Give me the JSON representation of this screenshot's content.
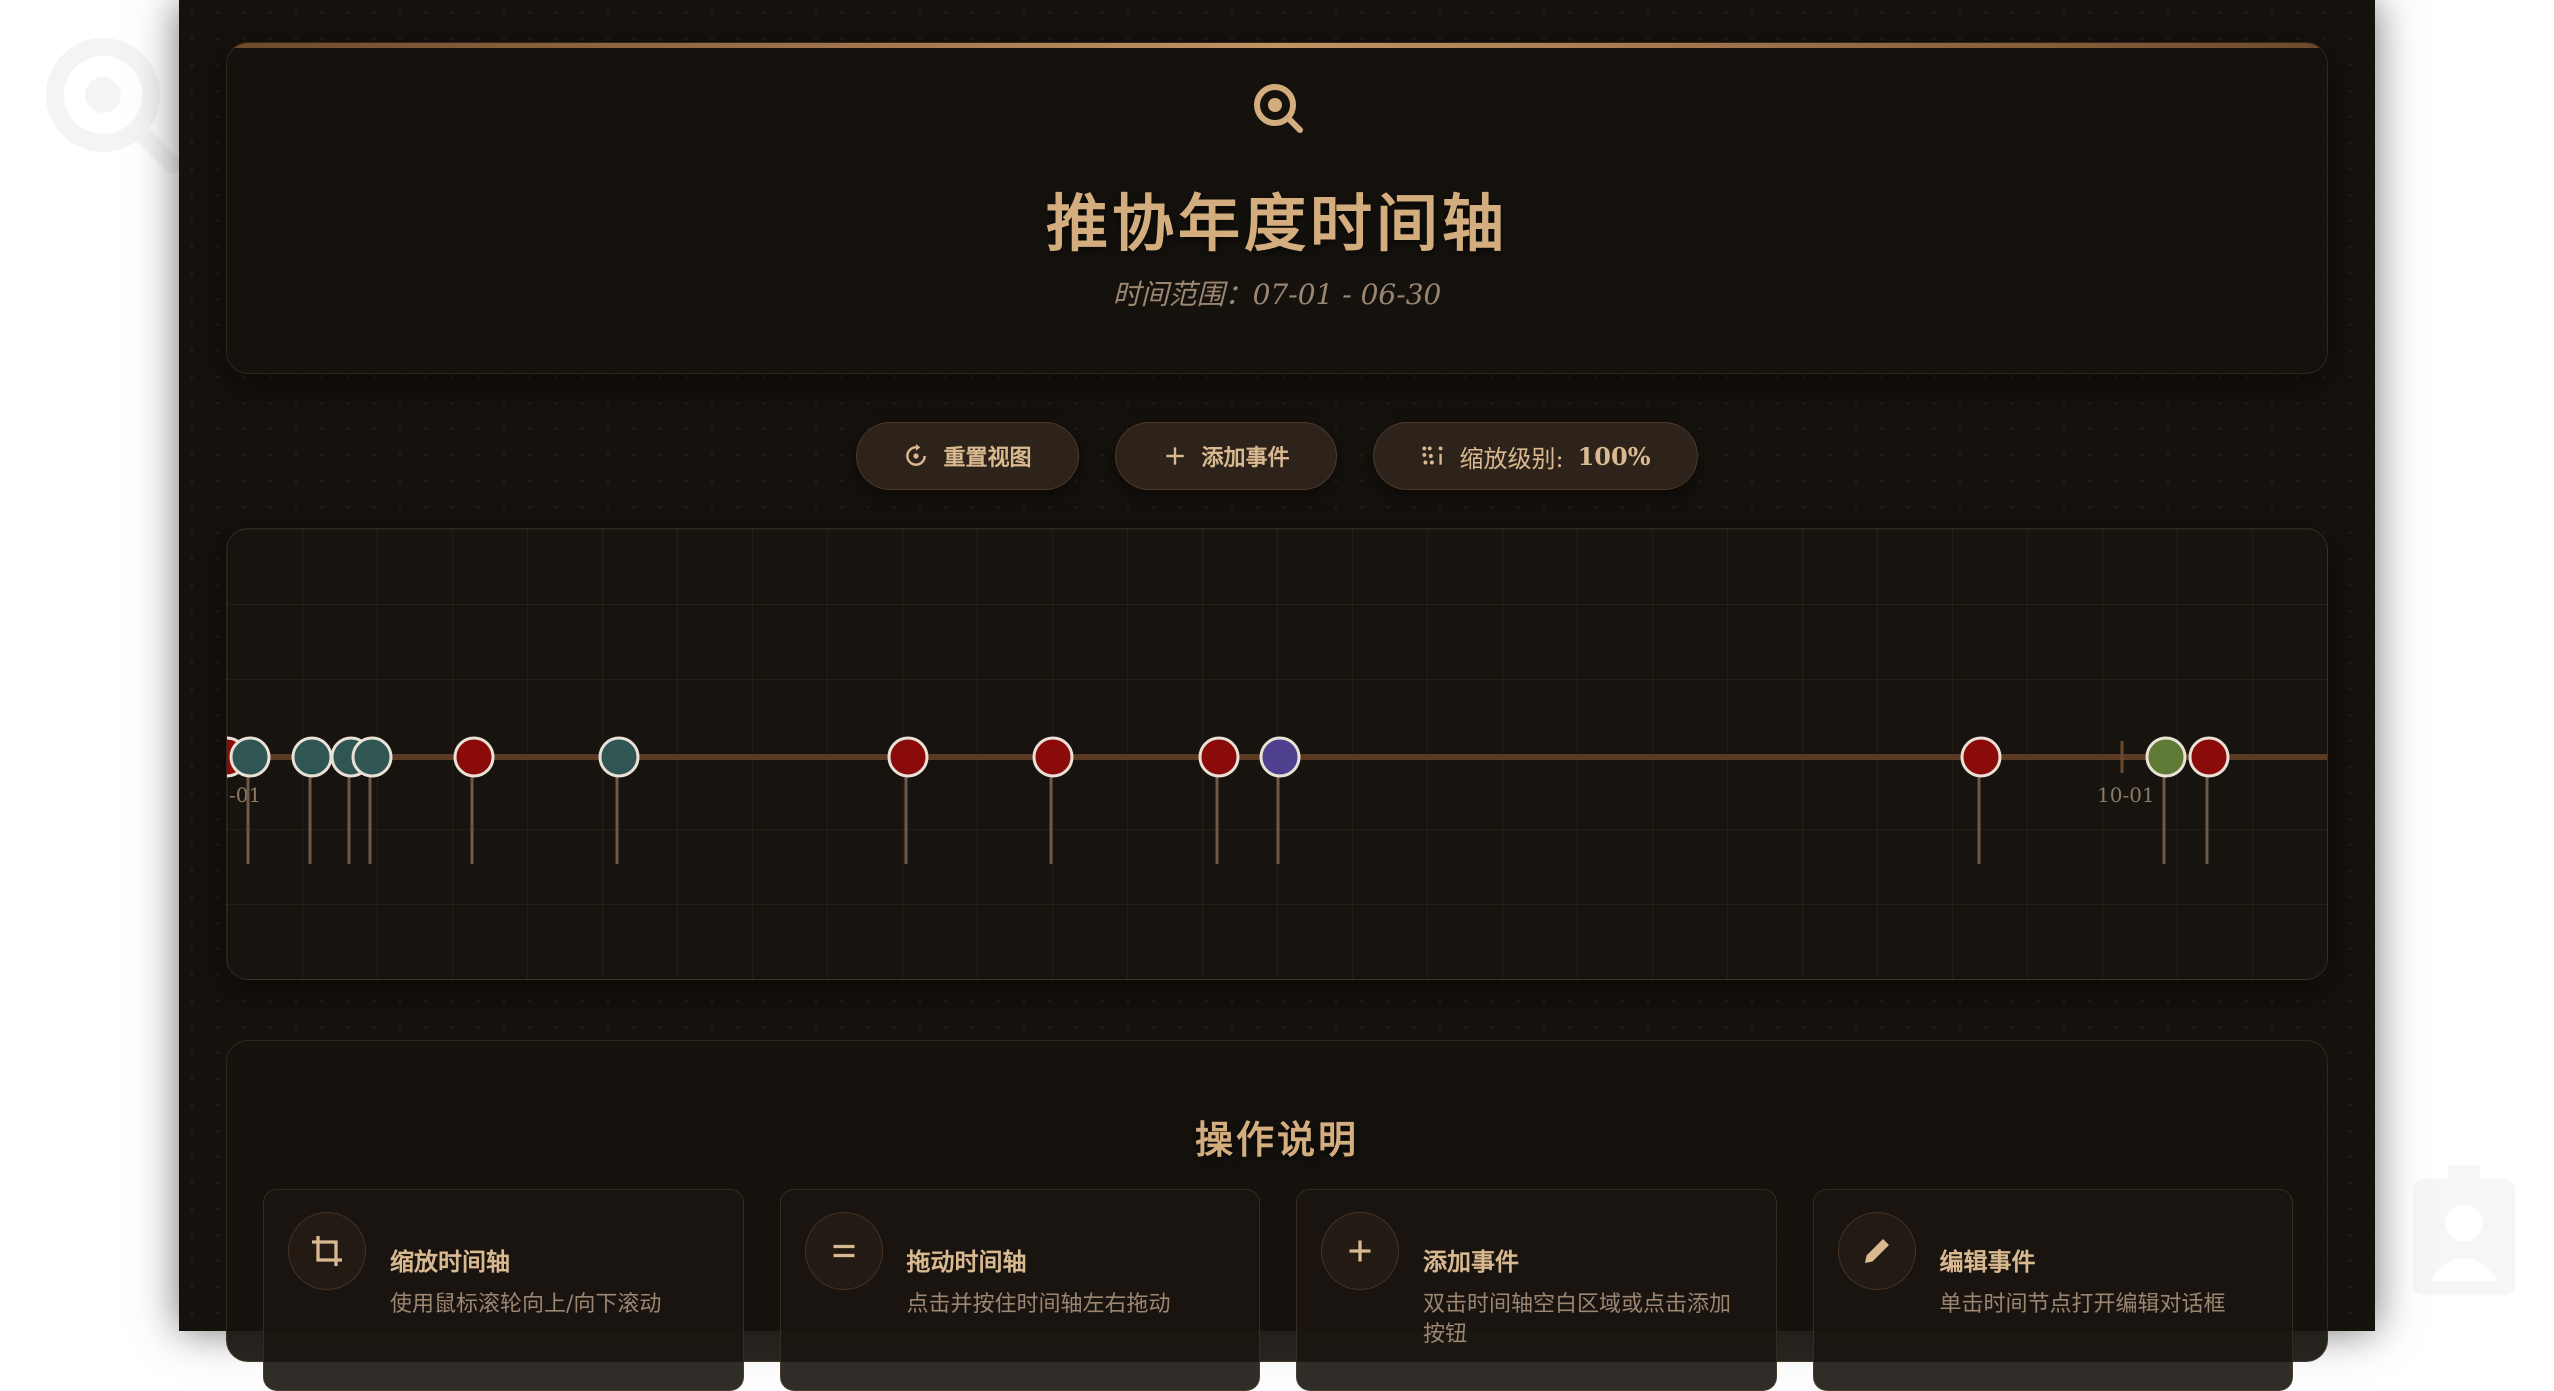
{
  "header": {
    "title": "推协年度时间轴",
    "subtitle": "时间范围：07-01 - 06-30"
  },
  "toolbar": {
    "reset_label": "重置视图",
    "add_label": "添加事件",
    "zoom_prefix": "缩放级别:",
    "zoom_value": "100%"
  },
  "timeline": {
    "tick_labels": [
      "-01",
      "10-01"
    ],
    "events": [
      {
        "color": "#8b0a0a"
      },
      {
        "color": "#2f5652"
      },
      {
        "color": "#2f5652"
      },
      {
        "color": "#2f5652"
      },
      {
        "color": "#2f5652"
      },
      {
        "color": "#8b0a0a"
      },
      {
        "color": "#2f5652"
      },
      {
        "color": "#8b0a0a"
      },
      {
        "color": "#8b0a0a"
      },
      {
        "color": "#8b0a0a"
      },
      {
        "color": "#4f3f8f"
      },
      {
        "color": "#8b0a0a"
      },
      {
        "color": "#5e7a34"
      },
      {
        "color": "#8b0a0a"
      }
    ]
  },
  "help": {
    "title": "操作说明",
    "items": [
      {
        "name": "缩放时间轴",
        "desc": "使用鼠标滚轮向上/向下滚动",
        "icon": "crop-icon"
      },
      {
        "name": "拖动时间轴",
        "desc": "点击并按住时间轴左右拖动",
        "icon": "drag-handle-icon"
      },
      {
        "name": "添加事件",
        "desc": "双击时间轴空白区域或点击添加按钮",
        "icon": "plus-icon"
      },
      {
        "name": "编辑事件",
        "desc": "单击时间节点打开编辑对话框",
        "icon": "pencil-icon"
      }
    ]
  },
  "colors": {
    "accent": "#d4ad7f",
    "background": "#15110d",
    "timeline_line": "#5a3a22"
  }
}
